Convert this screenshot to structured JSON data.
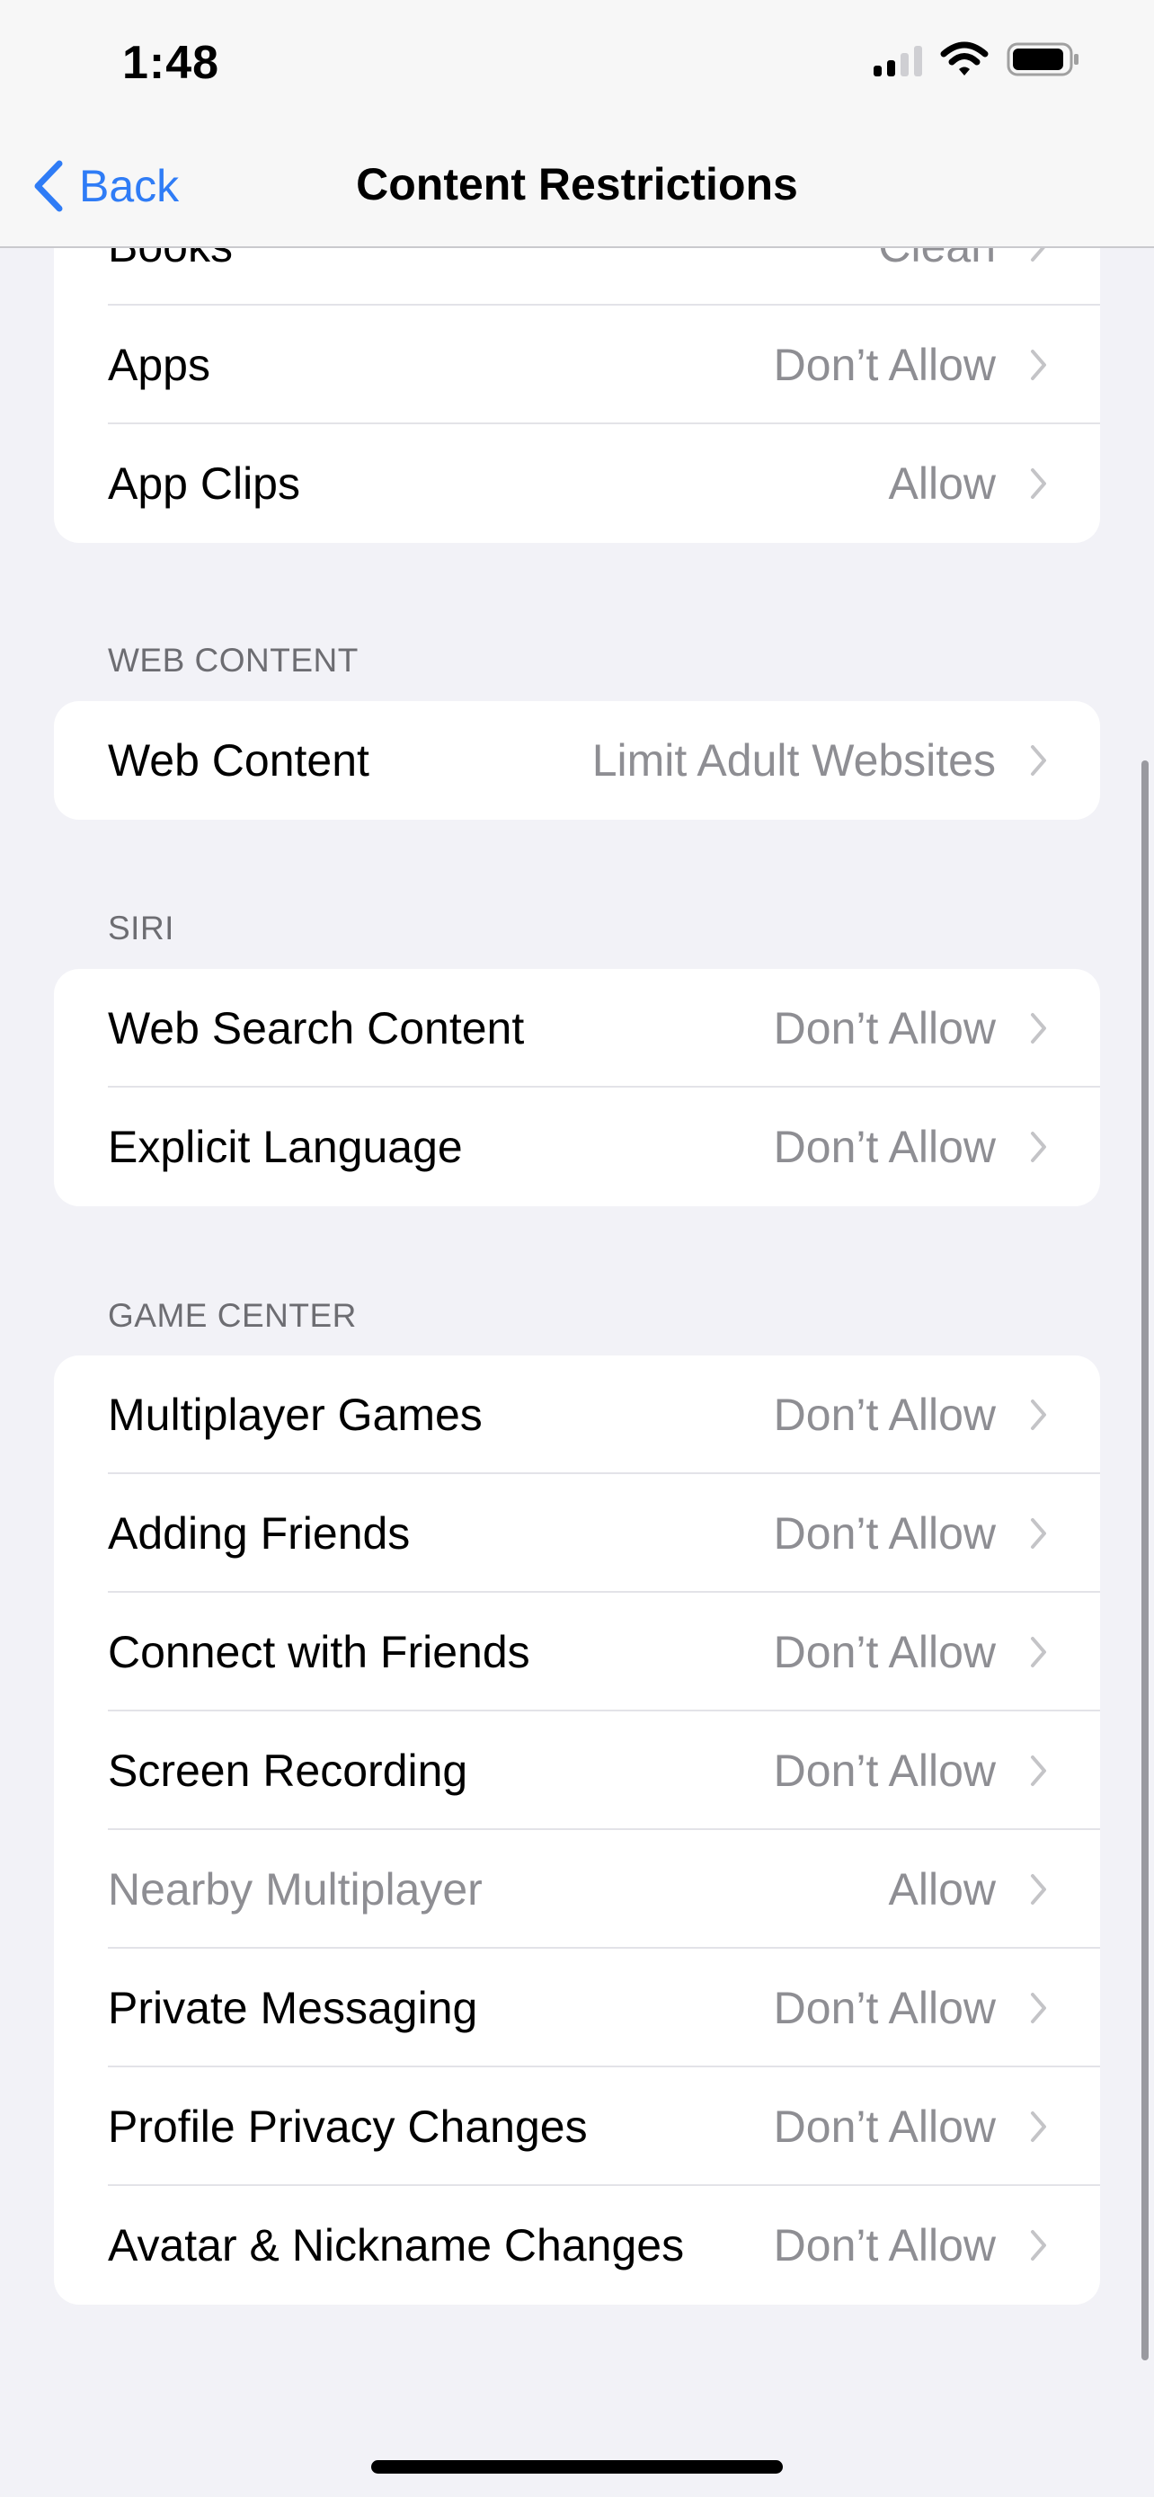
{
  "status_bar": {
    "time": "1:48",
    "icons": [
      "cellular-signal-icon",
      "wifi-icon",
      "battery-icon"
    ]
  },
  "nav": {
    "back_label": "Back",
    "title": "Content Restrictions",
    "accent_color": "#2f7cf6"
  },
  "store_group": {
    "rows": [
      {
        "label": "Books",
        "value": "Clean"
      },
      {
        "label": "Apps",
        "value": "Don’t Allow"
      },
      {
        "label": "App Clips",
        "value": "Allow"
      }
    ]
  },
  "web_content": {
    "header": "WEB CONTENT",
    "rows": [
      {
        "label": "Web Content",
        "value": "Limit Adult Websites"
      }
    ]
  },
  "siri": {
    "header": "SIRI",
    "rows": [
      {
        "label": "Web Search Content",
        "value": "Don’t Allow"
      },
      {
        "label": "Explicit Language",
        "value": "Don’t Allow"
      }
    ]
  },
  "game_center": {
    "header": "GAME CENTER",
    "rows": [
      {
        "label": "Multiplayer Games",
        "value": "Don’t Allow"
      },
      {
        "label": "Adding Friends",
        "value": "Don’t Allow"
      },
      {
        "label": "Connect with Friends",
        "value": "Don’t Allow"
      },
      {
        "label": "Screen Recording",
        "value": "Don’t Allow"
      },
      {
        "label": "Nearby Multiplayer",
        "value": "Allow",
        "disabled": true
      },
      {
        "label": "Private Messaging",
        "value": "Don’t Allow"
      },
      {
        "label": "Profile Privacy Changes",
        "value": "Don’t Allow"
      },
      {
        "label": "Avatar & Nickname Changes",
        "value": "Don’t Allow"
      }
    ]
  }
}
